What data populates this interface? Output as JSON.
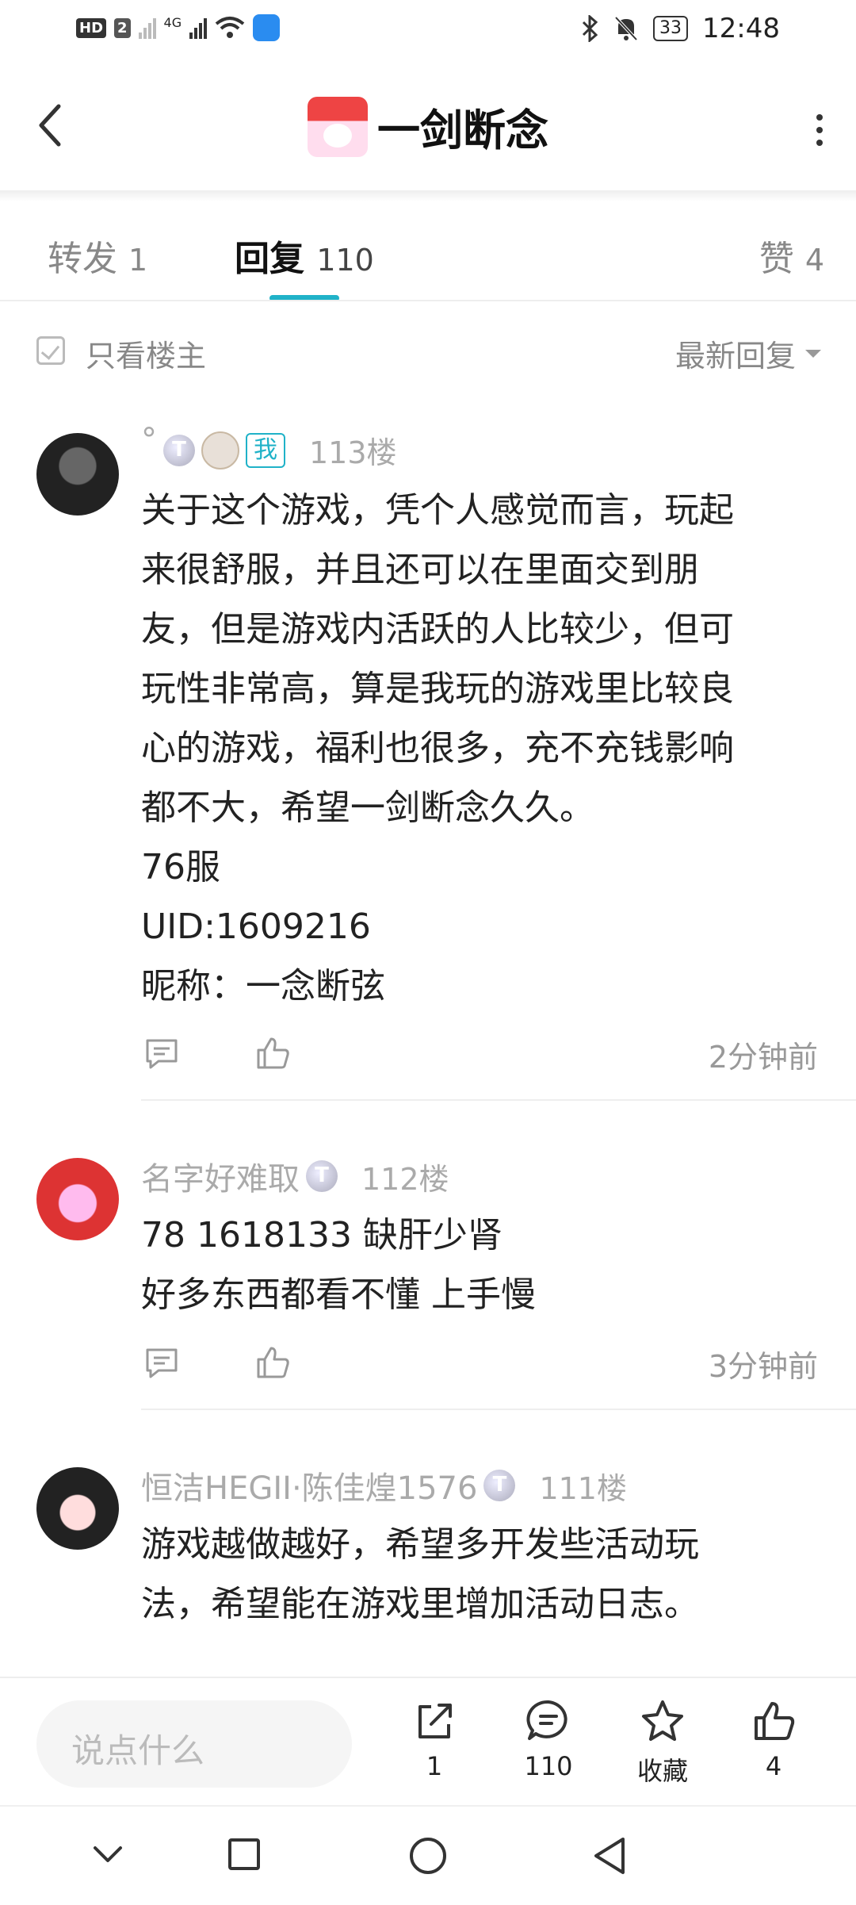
{
  "status_bar": {
    "hd_label": "HD",
    "sim2_label": "2",
    "network_label": "4G",
    "battery": "33",
    "time": "12:48"
  },
  "header": {
    "title": "一剑断念"
  },
  "tabs": [
    {
      "label": "转发",
      "count": "1"
    },
    {
      "label": "回复",
      "count": "110"
    },
    {
      "label": "赞",
      "count": "4"
    }
  ],
  "filter": {
    "only_op": "只看楼主",
    "sort": "最新回复"
  },
  "comments": [
    {
      "name": "°",
      "me_tag": "我",
      "floor": "113楼",
      "lines": [
        "关于这个游戏，凭个人感觉而言，玩起",
        "来很舒服，并且还可以在里面交到朋",
        "友，但是游戏内活跃的人比较少，但可",
        "玩性非常高，算是我玩的游戏里比较良",
        "心的游戏，福利也很多，充不充钱影响",
        "都不大，希望一剑断念久久。",
        "76服",
        "UID:1609216",
        "昵称：一念断弦"
      ],
      "time": "2分钟前"
    },
    {
      "name": "名字好难取",
      "floor": "112楼",
      "lines": [
        "78 1618133 缺肝少肾",
        "好多东西都看不懂 上手慢"
      ],
      "time": "3分钟前"
    },
    {
      "name": "恒洁HEGII·陈佳煌1576",
      "floor": "111楼",
      "lines": [
        "游戏越做越好，希望多开发些活动玩",
        "法，希望能在游戏里增加活动日志。"
      ]
    }
  ],
  "bottom_bar": {
    "input_placeholder": "说点什么",
    "share_count": "1",
    "comment_count": "110",
    "favorite_label": "收藏",
    "like_count": "4"
  },
  "colors": {
    "accent": "#20b2c8"
  }
}
